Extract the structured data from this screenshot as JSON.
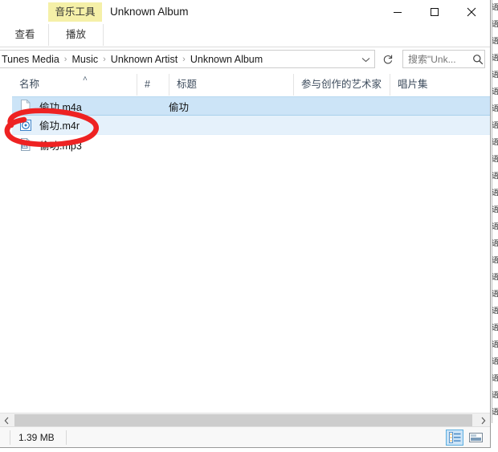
{
  "window": {
    "title": "Unknown Album",
    "contextual_tab_group": "音乐工具",
    "caption": {
      "minimize": "minimize-icon",
      "maximize": "maximize-icon",
      "close": "close-icon"
    }
  },
  "ribbon": {
    "tabs": [
      {
        "id": "view",
        "label": "查看"
      },
      {
        "id": "play",
        "label": "播放",
        "active": true
      }
    ],
    "collapse_label": "chevron-down-icon",
    "help_label": "?"
  },
  "address": {
    "breadcrumbs": [
      "Tunes Media",
      "Music",
      "Unknown Artist",
      "Unknown Album"
    ],
    "separator": "›",
    "dropdown_icon": "chevron-down-icon",
    "refresh_icon": "refresh-icon"
  },
  "search": {
    "value": "",
    "placeholder": "搜索\"Unk...",
    "icon": "search-icon"
  },
  "columns": [
    {
      "id": "name",
      "label": "名称",
      "sorted": true,
      "sort_caret": "˄"
    },
    {
      "id": "number",
      "label": "#"
    },
    {
      "id": "title",
      "label": "标题"
    },
    {
      "id": "artist",
      "label": "参与创作的艺术家"
    },
    {
      "id": "album",
      "label": "唱片集"
    }
  ],
  "files": [
    {
      "name": "偷功.m4a",
      "icon": "blank-file-icon",
      "number": "",
      "title": "偷功",
      "artist": "",
      "album": "",
      "state": "selected"
    },
    {
      "name": "偷功.m4r",
      "icon": "disc-file-icon",
      "number": "",
      "title": "",
      "artist": "",
      "album": "",
      "state": "focused"
    },
    {
      "name": "偷功.mp3",
      "icon": "media-file-icon",
      "number": "",
      "title": "",
      "artist": "",
      "album": "",
      "state": "normal"
    }
  ],
  "status": {
    "size": "1.39 MB",
    "view_buttons": [
      {
        "id": "details-view",
        "icon": "details-view-icon",
        "active": true
      },
      {
        "id": "large-icons-view",
        "icon": "large-icons-view-icon",
        "active": false
      }
    ]
  },
  "scrollbar": {
    "left_arrow": "‹",
    "right_arrow": "›"
  },
  "annotation": {
    "shape": "red-ellipse",
    "color": "#ee2222",
    "targets": "偷功.m4r"
  },
  "colors": {
    "contextual_tab_bg": "#f5f0a8",
    "selection_bg": "#cce4f7",
    "focus_bg": "#e5f1fb",
    "help_blue": "#1579c6",
    "annotation_red": "#ee2222"
  }
}
